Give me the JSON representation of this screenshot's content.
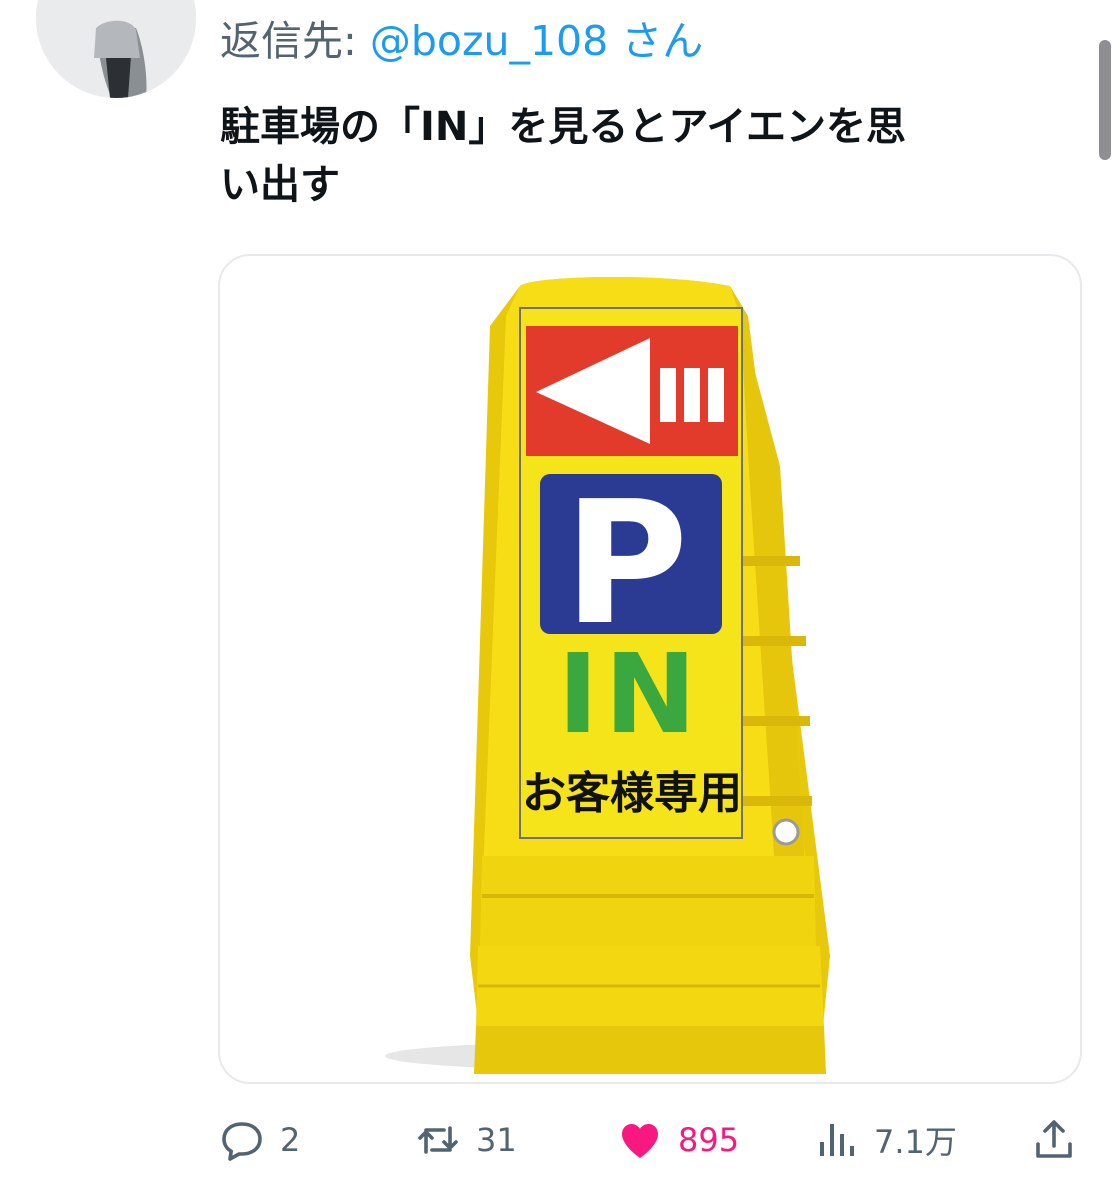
{
  "reply": {
    "prefix": "返信先: ",
    "handle": "@bozu_108",
    "suffix": " さん"
  },
  "tweet": {
    "text_line1": "駐車場の「IN」を見るとアイエンを思",
    "text_line2": "い出す"
  },
  "sign": {
    "big_letter": "P",
    "in_text": "IN",
    "caption": "お客様専用",
    "colors": {
      "body": "#f5d90a",
      "red_band": "#e23b2b",
      "p_block": "#2b3a93",
      "in_green": "#3aa83f"
    }
  },
  "actions": {
    "reply": {
      "icon": "reply-icon",
      "count": "2"
    },
    "repost": {
      "icon": "repost-icon",
      "count": "31"
    },
    "like": {
      "icon": "heart-icon",
      "count": "895",
      "active": true,
      "color": "#f91880"
    },
    "views": {
      "icon": "views-icon",
      "count": "7.1万"
    },
    "share": {
      "icon": "share-icon"
    }
  }
}
